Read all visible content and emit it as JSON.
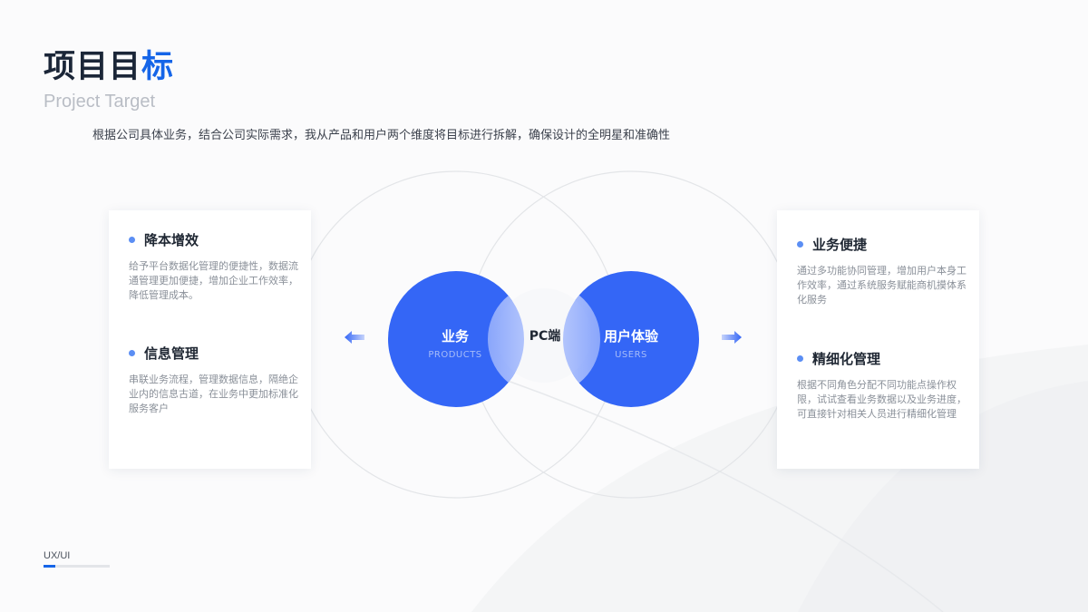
{
  "header": {
    "title_part1": "项目目",
    "title_part2": "标",
    "subtitle": "Project Target",
    "description": "根据公司具体业务，结合公司实际需求，我从产品和用户两个维度将目标进行拆解，确保设计的全明星和准确性"
  },
  "left_card": {
    "items": [
      {
        "title": "降本增效",
        "body": "给予平台数据化管理的便捷性，数据流通管理更加便捷，增加企业工作效率，降低管理成本。"
      },
      {
        "title": "信息管理",
        "body": "串联业务流程，管理数据信息，隔绝企业内的信息古道，在业务中更加标准化服务客户"
      }
    ]
  },
  "right_card": {
    "items": [
      {
        "title": "业务便捷",
        "body": "通过多功能协同管理，增加用户本身工作效率，通过系统服务赋能商机摸体系化服务"
      },
      {
        "title": "精细化管理",
        "body": "根据不同角色分配不同功能点操作权限，试试查看业务数据以及业务进度，可直接针对相关人员进行精细化管理"
      }
    ]
  },
  "venn": {
    "left_title": "业务",
    "left_subtitle": "PRODUCTS",
    "center_label": "PC端",
    "right_title": "用户体验",
    "right_subtitle": "USERS",
    "circle_color": "#3466f6"
  },
  "icons": {
    "left_arrow": "arrow-left-icon",
    "right_arrow": "arrow-right-icon"
  },
  "footer": {
    "label": "UX/UI",
    "progress": 0.18,
    "accent_color": "#1565e8"
  }
}
